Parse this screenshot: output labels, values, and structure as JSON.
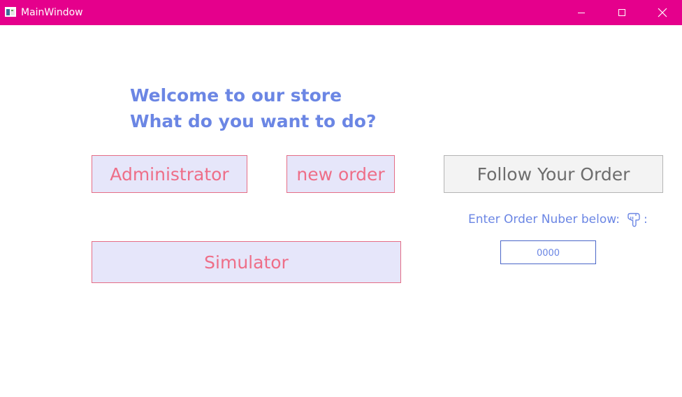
{
  "window": {
    "title": "MainWindow",
    "titlebar_color": "#e5008c",
    "icons": {
      "app": "app-window-icon",
      "minimize": "minimize-icon",
      "maximize": "maximize-icon",
      "close": "close-icon"
    }
  },
  "main": {
    "welcome_line1": "Welcome to our store",
    "welcome_line2": "What do you want to do?",
    "buttons": {
      "administrator": "Administrator",
      "new_order": "new order",
      "simulator": "Simulator",
      "follow_order": "Follow Your Order"
    },
    "order_lookup": {
      "label": "Enter Order Nuber below:",
      "label_suffix": ":",
      "hand_icon": "pointing-down-hand-icon",
      "value": "0000"
    }
  },
  "colors": {
    "accent_blue": "#6b86e4",
    "button_fill": "#e6e6fa",
    "button_text": "#ee6e88",
    "button_border": "#e56d86",
    "gray_button_fill": "#f3f3f3",
    "gray_button_text": "#6d6d6d"
  }
}
